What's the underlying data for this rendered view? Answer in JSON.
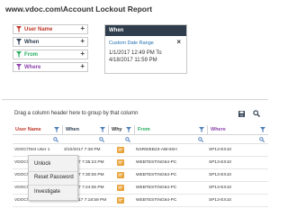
{
  "page": {
    "title": "www.vdoc.com\\Account Lockout Report"
  },
  "filters": [
    {
      "label": "User Name",
      "color": "#c0392b",
      "plus": "+"
    },
    {
      "label": "When",
      "color": "#2c3e50",
      "plus": "+"
    },
    {
      "label": "From",
      "color": "#27ae60",
      "plus": "+"
    },
    {
      "label": "Where",
      "color": "#8e44ad",
      "plus": "+"
    }
  ],
  "when_panel": {
    "title": "When",
    "range_type": "Custom Date Range",
    "close": "×",
    "range_line1": "1/1/2017 12:49 PM To",
    "range_line2": "4/18/2017 11:59 PM"
  },
  "toolbar": {
    "group_hint": "Drag a column header here to group by that column"
  },
  "grid": {
    "columns": {
      "user": "User Name",
      "when": "When",
      "why": "Why",
      "from": "From",
      "where": "Where"
    },
    "rows": [
      {
        "user": "VDOC\\Test User 1",
        "when": "3/10/2017 7:38 PM",
        "from": "NSRWEB23-ABHISH",
        "where": "SP13-EX10"
      },
      {
        "user": "VDOC\\Test User 1",
        "when": "3/3/2017 7:35:23 PM",
        "from": "WEBTESTING64-PC",
        "where": "SP13-EX10"
      },
      {
        "user": "VDOC\\Test User 1",
        "when": "3/3/2017 7:30:06 PM",
        "from": "WEBTESTING64-PC",
        "where": "SP13-EX10"
      },
      {
        "user": "VDOC\\Test User 1",
        "when": "3/3/2017 7:24:05 PM",
        "from": "WEBTESTING64-PC",
        "where": "SP13-EX10"
      },
      {
        "user": "VDOC\\Administrator",
        "when": "3/20/2017 7:18:59 PM",
        "from": "WEBTESTING64-PC",
        "where": "SP13-EX10"
      }
    ]
  },
  "context_menu": {
    "unlock": "Unlock",
    "reset_password": "Reset Password",
    "investigate": "Investigate"
  },
  "colors": {
    "panel_header": "#2f3d4d",
    "link": "#1f6fb2",
    "grid_icon": "#4a7bb7",
    "why_icon": "#e8a33a"
  },
  "icons": {
    "filter_header": "funnel-icon",
    "grid_filter": "search-icon",
    "save": "save-icon",
    "search": "search-icon"
  }
}
